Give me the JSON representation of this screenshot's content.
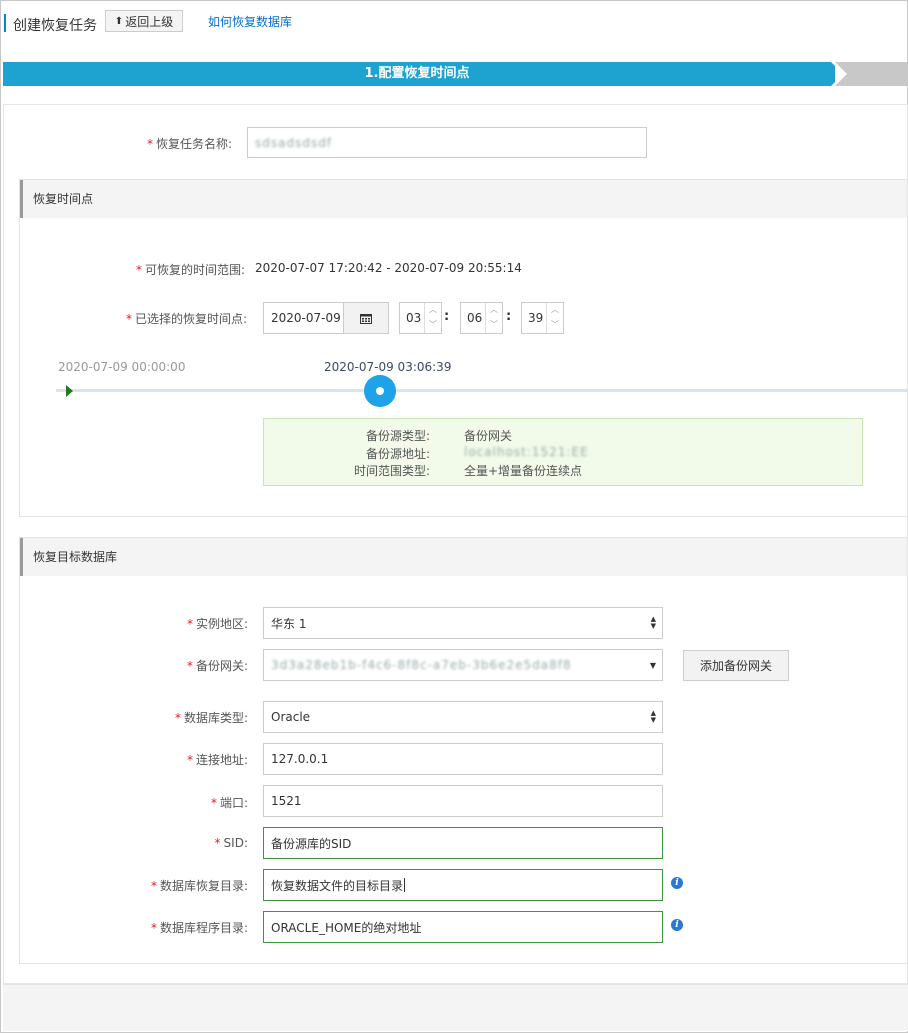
{
  "header": {
    "title": "创建恢复任务",
    "back_label": "返回上级",
    "help_link": "如何恢复数据库"
  },
  "steps": [
    {
      "label": "1.配置恢复时间点",
      "active": true
    },
    {
      "label": "",
      "active": false
    }
  ],
  "task_name": {
    "label": "恢复任务名称:",
    "value": "sdsadsdsdf"
  },
  "time_section": {
    "title": "恢复时间点",
    "range_label": "可恢复的时间范围:",
    "range_value": "2020-07-07 17:20:42 - 2020-07-09 20:55:14",
    "selected_label": "已选择的恢复时间点:",
    "date_value": "2020-07-09",
    "calendar_icon": "calendar-icon",
    "hour": "03",
    "minute": "06",
    "second": "39",
    "colon": ":",
    "slider_start_label": "2020-07-09 00:00:00",
    "slider_current_label": "2020-07-09 03:06:39",
    "slider_position_fraction": 0.13,
    "info": {
      "source_type_label": "备份源类型:",
      "source_type_value": "备份网关",
      "source_addr_label": "备份源地址:",
      "source_addr_value": "localhost:1521:EE",
      "range_type_label": "时间范围类型:",
      "range_type_value": "全量+增量备份连续点"
    }
  },
  "target_section": {
    "title": "恢复目标数据库",
    "region_label": "实例地区:",
    "region_value": "华东 1",
    "gateway_label": "备份网关:",
    "gateway_value": "3d3a28eb1b-f4c6-8f8c-a7eb-3b6e2e5da8f8",
    "add_gateway_label": "添加备份网关",
    "db_type_label": "数据库类型:",
    "db_type_value": "Oracle",
    "host_label": "连接地址:",
    "host_value": "127.0.0.1",
    "port_label": "端口:",
    "port_value": "1521",
    "sid_label": "SID:",
    "sid_value": "备份源库的SID",
    "restore_dir_label": "数据库恢复目录:",
    "restore_dir_value": "恢复数据文件的目标目录",
    "program_dir_label": "数据库程序目录:",
    "program_dir_value": "ORACLE_HOME的绝对地址"
  },
  "colors": {
    "accent": "#1ea2d0",
    "required": "#e02020",
    "link": "#0070cc",
    "valid_border": "#3a9a3a",
    "info_bg": "#f2fbea"
  }
}
